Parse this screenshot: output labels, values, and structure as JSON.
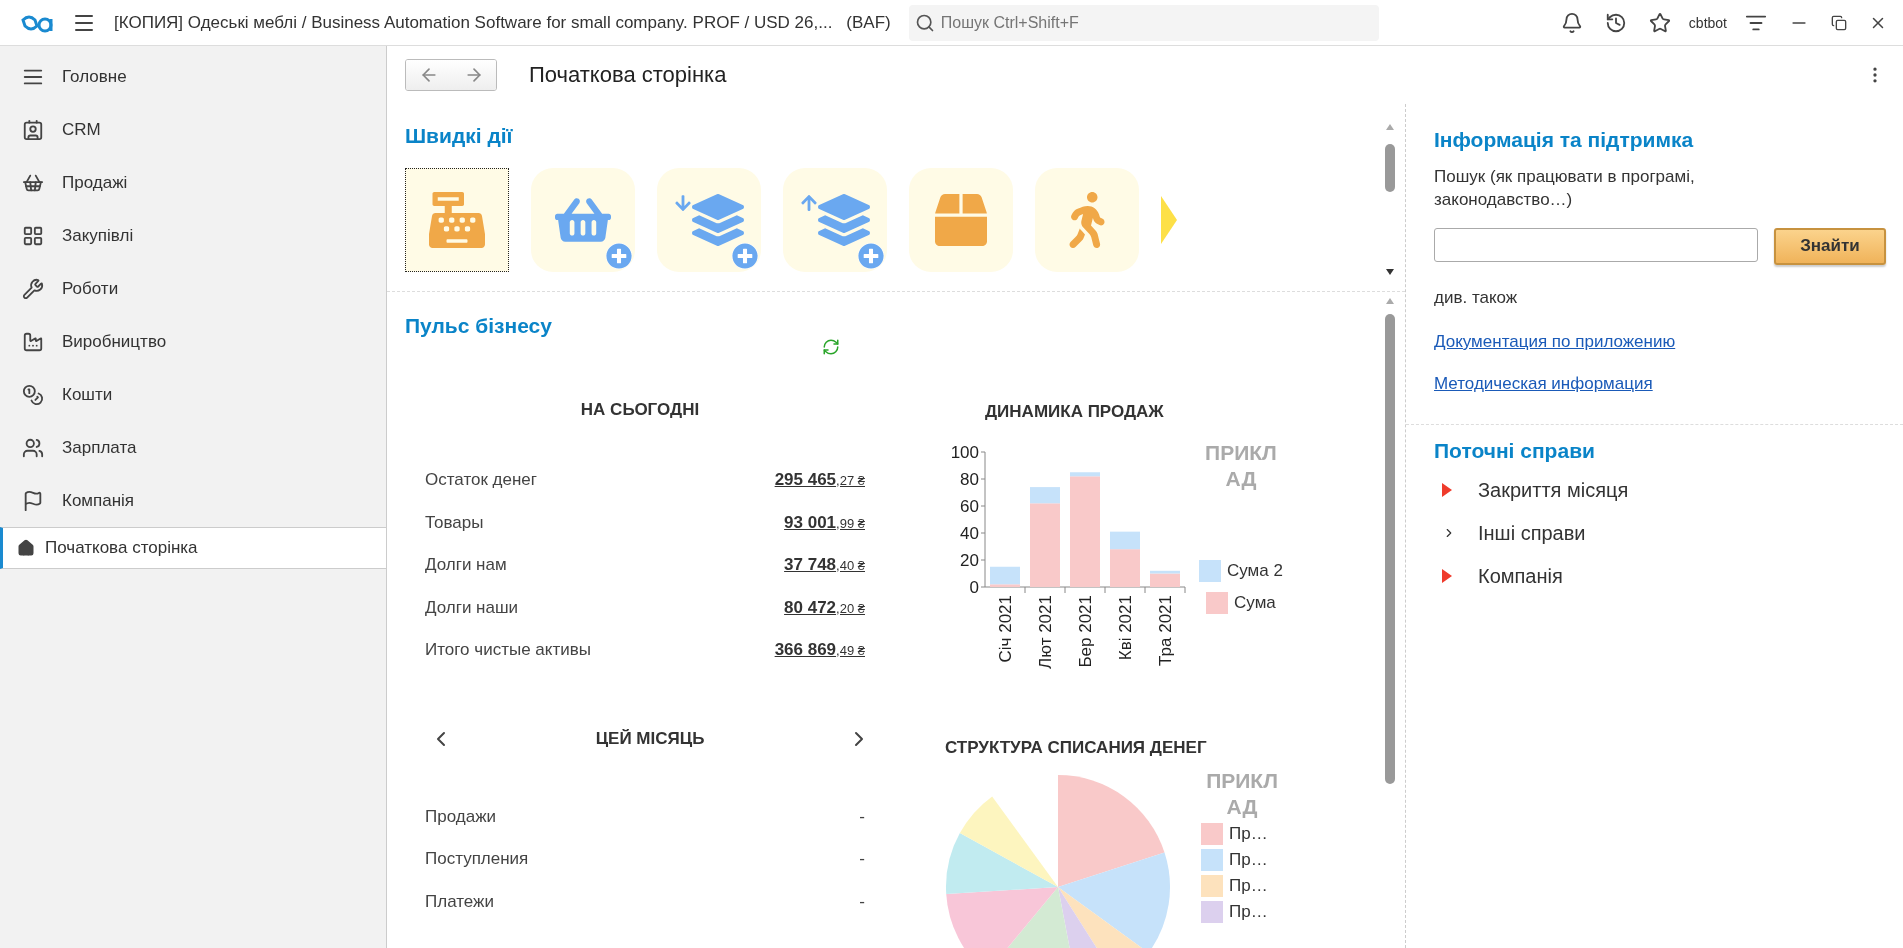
{
  "top_bar": {
    "title": "[КОПИЯ] Одеські меблі / Business Automation Software for small company. PROF / USD 26,...",
    "suffix": "(BAF)",
    "search_placeholder": "Пошук Ctrl+Shift+F",
    "user": "cbtbot"
  },
  "sidebar": {
    "items": [
      {
        "label": "Головне",
        "selected": false
      },
      {
        "label": "CRM",
        "selected": false
      },
      {
        "label": "Продажі",
        "selected": false
      },
      {
        "label": "Закупівлі",
        "selected": false
      },
      {
        "label": "Роботи",
        "selected": false
      },
      {
        "label": "Виробництво",
        "selected": false
      },
      {
        "label": "Кошти",
        "selected": false
      },
      {
        "label": "Зарплата",
        "selected": false
      },
      {
        "label": "Компанія",
        "selected": false
      }
    ],
    "open_pages": [
      {
        "label": "Початкова сторінка",
        "selected": true
      }
    ]
  },
  "page": {
    "title": "Початкова сторінка"
  },
  "quick_actions": {
    "title": "Швидкі дії",
    "items": [
      {
        "selected": true
      },
      {
        "selected": false
      },
      {
        "selected": false
      },
      {
        "selected": false
      },
      {
        "selected": false
      },
      {
        "selected": false
      }
    ]
  },
  "pulse": {
    "title": "Пульс бізнесу",
    "today": {
      "title": "НА СЬОГОДНІ",
      "rows": [
        {
          "label": "Остаток денег",
          "amount": "295 465",
          "fraction": ",27 ₴"
        },
        {
          "label": "Товары",
          "amount": "93 001",
          "fraction": ",99 ₴"
        },
        {
          "label": "Долги нам",
          "amount": "37 748",
          "fraction": ",40 ₴"
        },
        {
          "label": "Долги наши",
          "amount": "80 472",
          "fraction": ",20 ₴"
        },
        {
          "label": "Итого чистые активы",
          "amount": "366 869",
          "fraction": ",49 ₴"
        }
      ]
    },
    "month": {
      "title": "ЦЕЙ МІСЯЦЬ",
      "rows": [
        {
          "label": "Продажи",
          "value": "-"
        },
        {
          "label": "Поступления",
          "value": "-"
        },
        {
          "label": "Платежи",
          "value": "-"
        }
      ]
    },
    "sales_chart": {
      "title": "ДИНАМИКА ПРОДАЖ",
      "watermark": "ПРИКЛАД",
      "chart_data": {
        "type": "bar",
        "stacked": true,
        "legend": "right",
        "categories": [
          "Січ 2021",
          "Лют 2021",
          "Бер 2021",
          "Кві 2021",
          "Тра 2021"
        ],
        "ylim": [
          0,
          100
        ],
        "yticks": [
          0,
          20,
          40,
          60,
          80,
          100
        ],
        "series": [
          {
            "name": "Сума",
            "color": "#f9c9c9",
            "values": [
              2,
              62,
              82,
              28,
              10
            ]
          },
          {
            "name": "Сума 2",
            "color": "#c6e2fa",
            "values": [
              13,
              12,
              3,
              13,
              2
            ]
          }
        ]
      }
    },
    "expense_chart": {
      "title": "СТРУКТУРА СПИСАНИЯ ДЕНЕГ",
      "watermark": "ПРИКЛАД",
      "legend": [
        {
          "label": "Пр…",
          "color": "#f9c9c9"
        },
        {
          "label": "Пр…",
          "color": "#c6e2fa"
        },
        {
          "label": "Пр…",
          "color": "#fde2bd"
        },
        {
          "label": "Пр…",
          "color": "#dcd0ee"
        }
      ]
    }
  },
  "info": {
    "title": "Інформація та підтримка",
    "search_label": "Пошук (як працювати в програмі, законодавство…)",
    "button": "Знайти",
    "see_also": "див. також",
    "links": [
      "Документация по приложению",
      "Методическая информация"
    ]
  },
  "tasks": {
    "title": "Поточні справи",
    "items": [
      {
        "label": "Закриття місяця",
        "attention": true
      },
      {
        "label": "Інші справи",
        "attention": false
      },
      {
        "label": "Компанія",
        "attention": true
      }
    ]
  }
}
